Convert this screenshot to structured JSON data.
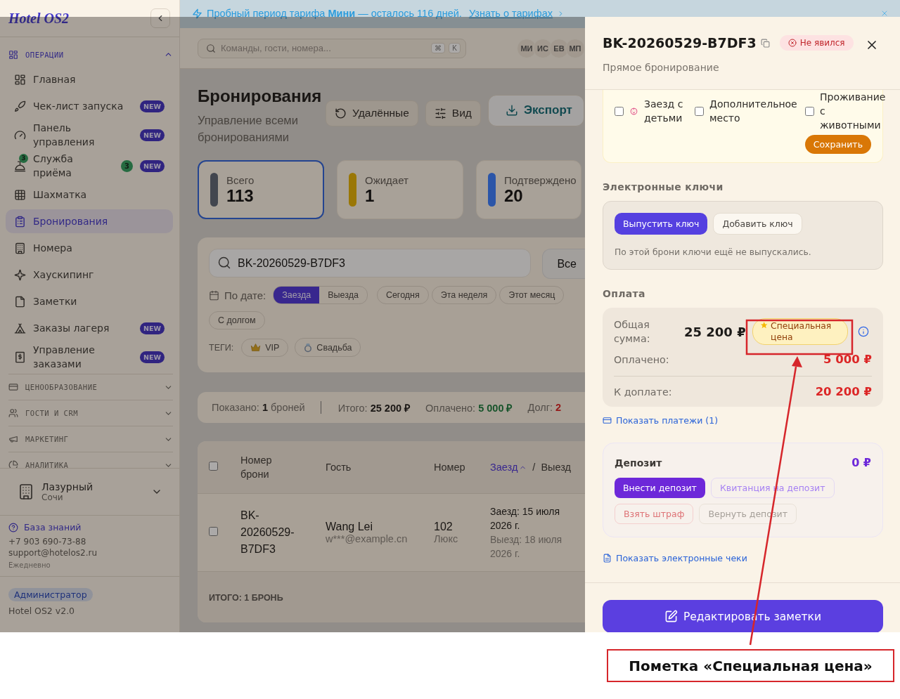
{
  "banner": {
    "text": "Пробный период тарифа **Мини** — осталось 116 дней.",
    "link": "Узнать о тарифах"
  },
  "sidebar": {
    "logo": "Hotel OS2",
    "sections": [
      {
        "label": "ОПЕРАЦИИ",
        "expanded": true,
        "items": [
          {
            "label": "Главная",
            "selected": false
          },
          {
            "label": "Чек-лист запуска",
            "badge": "NEW",
            "selected": false
          },
          {
            "label": "Панель управления",
            "badge": "NEW",
            "selected": false
          },
          {
            "label": "Служба приёма",
            "icon_count": "3",
            "count": "3",
            "badge": "NEW",
            "selected": false
          },
          {
            "label": "Шахматка",
            "selected": false
          },
          {
            "label": "Бронирования",
            "selected": true
          },
          {
            "label": "Номера",
            "selected": false
          },
          {
            "label": "Хаускипинг",
            "selected": false
          },
          {
            "label": "Заметки",
            "selected": false
          },
          {
            "label": "Заказы лагеря",
            "badge": "NEW",
            "selected": false
          },
          {
            "label": "Управление заказами",
            "badge": "NEW",
            "selected": false
          }
        ]
      },
      {
        "label": "ЦЕНООБРАЗОВАНИЕ",
        "expanded": false
      },
      {
        "label": "ГОСТИ И CRM",
        "expanded": false
      },
      {
        "label": "МАРКЕТИНГ",
        "expanded": false
      },
      {
        "label": "АНАЛИТИКА",
        "expanded": false
      }
    ],
    "property": {
      "name": "Лазурный",
      "city": "Сочи"
    },
    "support": {
      "link": "База знаний",
      "phone": "+7 903 690-73-88",
      "email": "support@hotelos2.ru",
      "hours": "Ежедневно"
    },
    "role": "Администратор",
    "version": "Hotel OS2 v2.0"
  },
  "topbar": {
    "search_placeholder": "Команды, гости, номера...",
    "shortcut": [
      "⌘",
      "K"
    ],
    "avatars": [
      "МИ",
      "ИС",
      "ЕВ",
      "МП"
    ]
  },
  "page": {
    "title": "Бронирования",
    "subtitle": "Управление всеми бронированиями",
    "actions": [
      {
        "label": "Удалённые",
        "kind": "secondary"
      },
      {
        "label": "Вид",
        "kind": "secondary"
      },
      {
        "label": "Экспорт",
        "kind": "export"
      }
    ]
  },
  "stats": [
    {
      "label": "Всего",
      "value": "113",
      "color": "#42464f",
      "selected": true
    },
    {
      "label": "Ожидает",
      "value": "1",
      "color": "#9a7706",
      "selected": false
    },
    {
      "label": "Подтверждено",
      "value": "20",
      "color": "#2b55a8",
      "selected": false
    }
  ],
  "filters": {
    "search": "BK-20260529-B7DF3",
    "status": "Все",
    "date_label": "По дате:",
    "date_modes": [
      {
        "label": "Заезда",
        "selected": true
      },
      {
        "label": "Выезда",
        "selected": false
      }
    ],
    "quick": [
      {
        "label": "Сегодня",
        "selected": false
      },
      {
        "label": "Эта неделя",
        "selected": false
      },
      {
        "label": "Этот месяц",
        "selected": false
      },
      {
        "label": "С долгом",
        "selected": false
      }
    ],
    "tags_label": "ТЕГИ:",
    "tags": [
      {
        "label": "VIP"
      },
      {
        "label": "Свадьба"
      }
    ]
  },
  "summary": [
    {
      "label": "Показано:",
      "value": "1",
      "suffix": "броней",
      "kind": "count"
    },
    {
      "label": "Итого:",
      "value": "25 200 ₽",
      "kind": "total"
    },
    {
      "label": "Оплачено:",
      "value": "5 000 ₽",
      "kind": "paid"
    },
    {
      "label": "Долг:",
      "value": "2",
      "kind": "debt"
    }
  ],
  "table": {
    "all_selected": false,
    "columns": [
      {
        "label": "Номер брони",
        "sorted": false
      },
      {
        "label": "Гость",
        "sorted": false
      },
      {
        "label": "Номер",
        "sorted": false
      },
      {
        "label": "Заезд",
        "sorted": true
      },
      {
        "label": "Выезд",
        "sorted": false
      }
    ],
    "separator": "/",
    "rows": [
      {
        "selected": false,
        "id": "BK-20260529-B7DF3",
        "guest": "Wang Lei",
        "email": "w***@example.cn",
        "room": "102",
        "room_type": "Люкс",
        "checkin": "Заезд: 15 июля 2026 г.",
        "checkout": "Выезд: 18 июля 2026 г."
      }
    ],
    "footer": "ИТОГО: 1 БРОНЬ"
  },
  "drawer": {
    "title": "BK-20260529-B7DF3",
    "status": "Не явился",
    "source": "Прямое бронирование",
    "options": [
      {
        "label": "Заезд с детьми",
        "checked": false
      },
      {
        "label": "Дополнительное место",
        "checked": false
      },
      {
        "label": "Проживание с животными",
        "checked": false
      }
    ],
    "save": "Сохранить",
    "keys": {
      "title": "Электронные ключи",
      "actions": [
        {
          "label": "Выпустить ключ",
          "kind": "primary"
        },
        {
          "label": "Добавить ключ",
          "kind": "secondary"
        }
      ],
      "note": "По этой брони ключи ещё не выпускались."
    },
    "payment": {
      "title": "Оплата",
      "total_label": "Общая сумма:",
      "total": "25 200 ₽",
      "badge": "Специальная цена",
      "paid_label": "Оплачено:",
      "paid": "5 000 ₽",
      "due_label": "К доплате:",
      "due": "20 200 ₽",
      "link": "Показать платежи (1)"
    },
    "deposit": {
      "title": "Депозит",
      "amount": "0 ₽",
      "actions": [
        {
          "label": "Внести депозит",
          "kind": "primary",
          "disabled": false
        },
        {
          "label": "Квитанция на депозит",
          "kind": "outline",
          "disabled": true
        },
        {
          "label": "Взять штраф",
          "kind": "danger",
          "disabled": true
        },
        {
          "label": "Вернуть депозит",
          "kind": "neutral",
          "disabled": true
        }
      ]
    },
    "receipts_link": "Показать электронные чеки",
    "edit_notes": "Редактировать заметки"
  },
  "annotation": {
    "text": "Пометка «Специальная цена»"
  }
}
